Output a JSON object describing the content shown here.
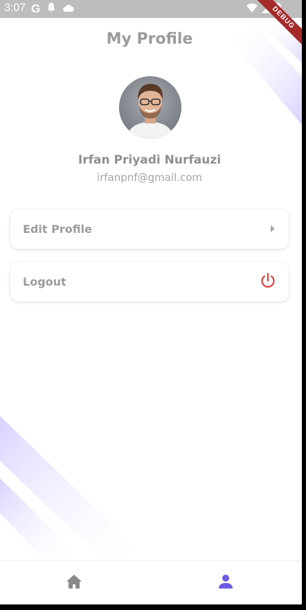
{
  "status_bar": {
    "time": "3:07",
    "left_icons": [
      "google-icon",
      "notification-bell-icon",
      "cloud-icon"
    ],
    "right_icons": [
      "wifi-icon",
      "signal-icon",
      "battery-icon"
    ],
    "google_glyph": "G"
  },
  "debug_banner": "DEBUG",
  "page": {
    "title": "My Profile"
  },
  "profile": {
    "name": "Irfan Priyadi Nurfauzi",
    "email": "irfanpnf@gmail.com"
  },
  "menu": [
    {
      "label": "Edit Profile",
      "icon": "chevron-right-icon"
    },
    {
      "label": "Logout",
      "icon": "power-icon",
      "icon_color": "#e53935"
    }
  ],
  "bottom_nav": {
    "items": [
      {
        "name": "home",
        "icon": "home-icon",
        "selected": false,
        "color": "#8a8a8a"
      },
      {
        "name": "profile",
        "icon": "person-icon",
        "selected": true,
        "color": "#6c5ce7"
      }
    ]
  },
  "colors": {
    "accent": "#6c5ce7",
    "stripe": "#dcd7ff",
    "text_muted": "#9a9a9a",
    "logout_red": "#e53935"
  }
}
